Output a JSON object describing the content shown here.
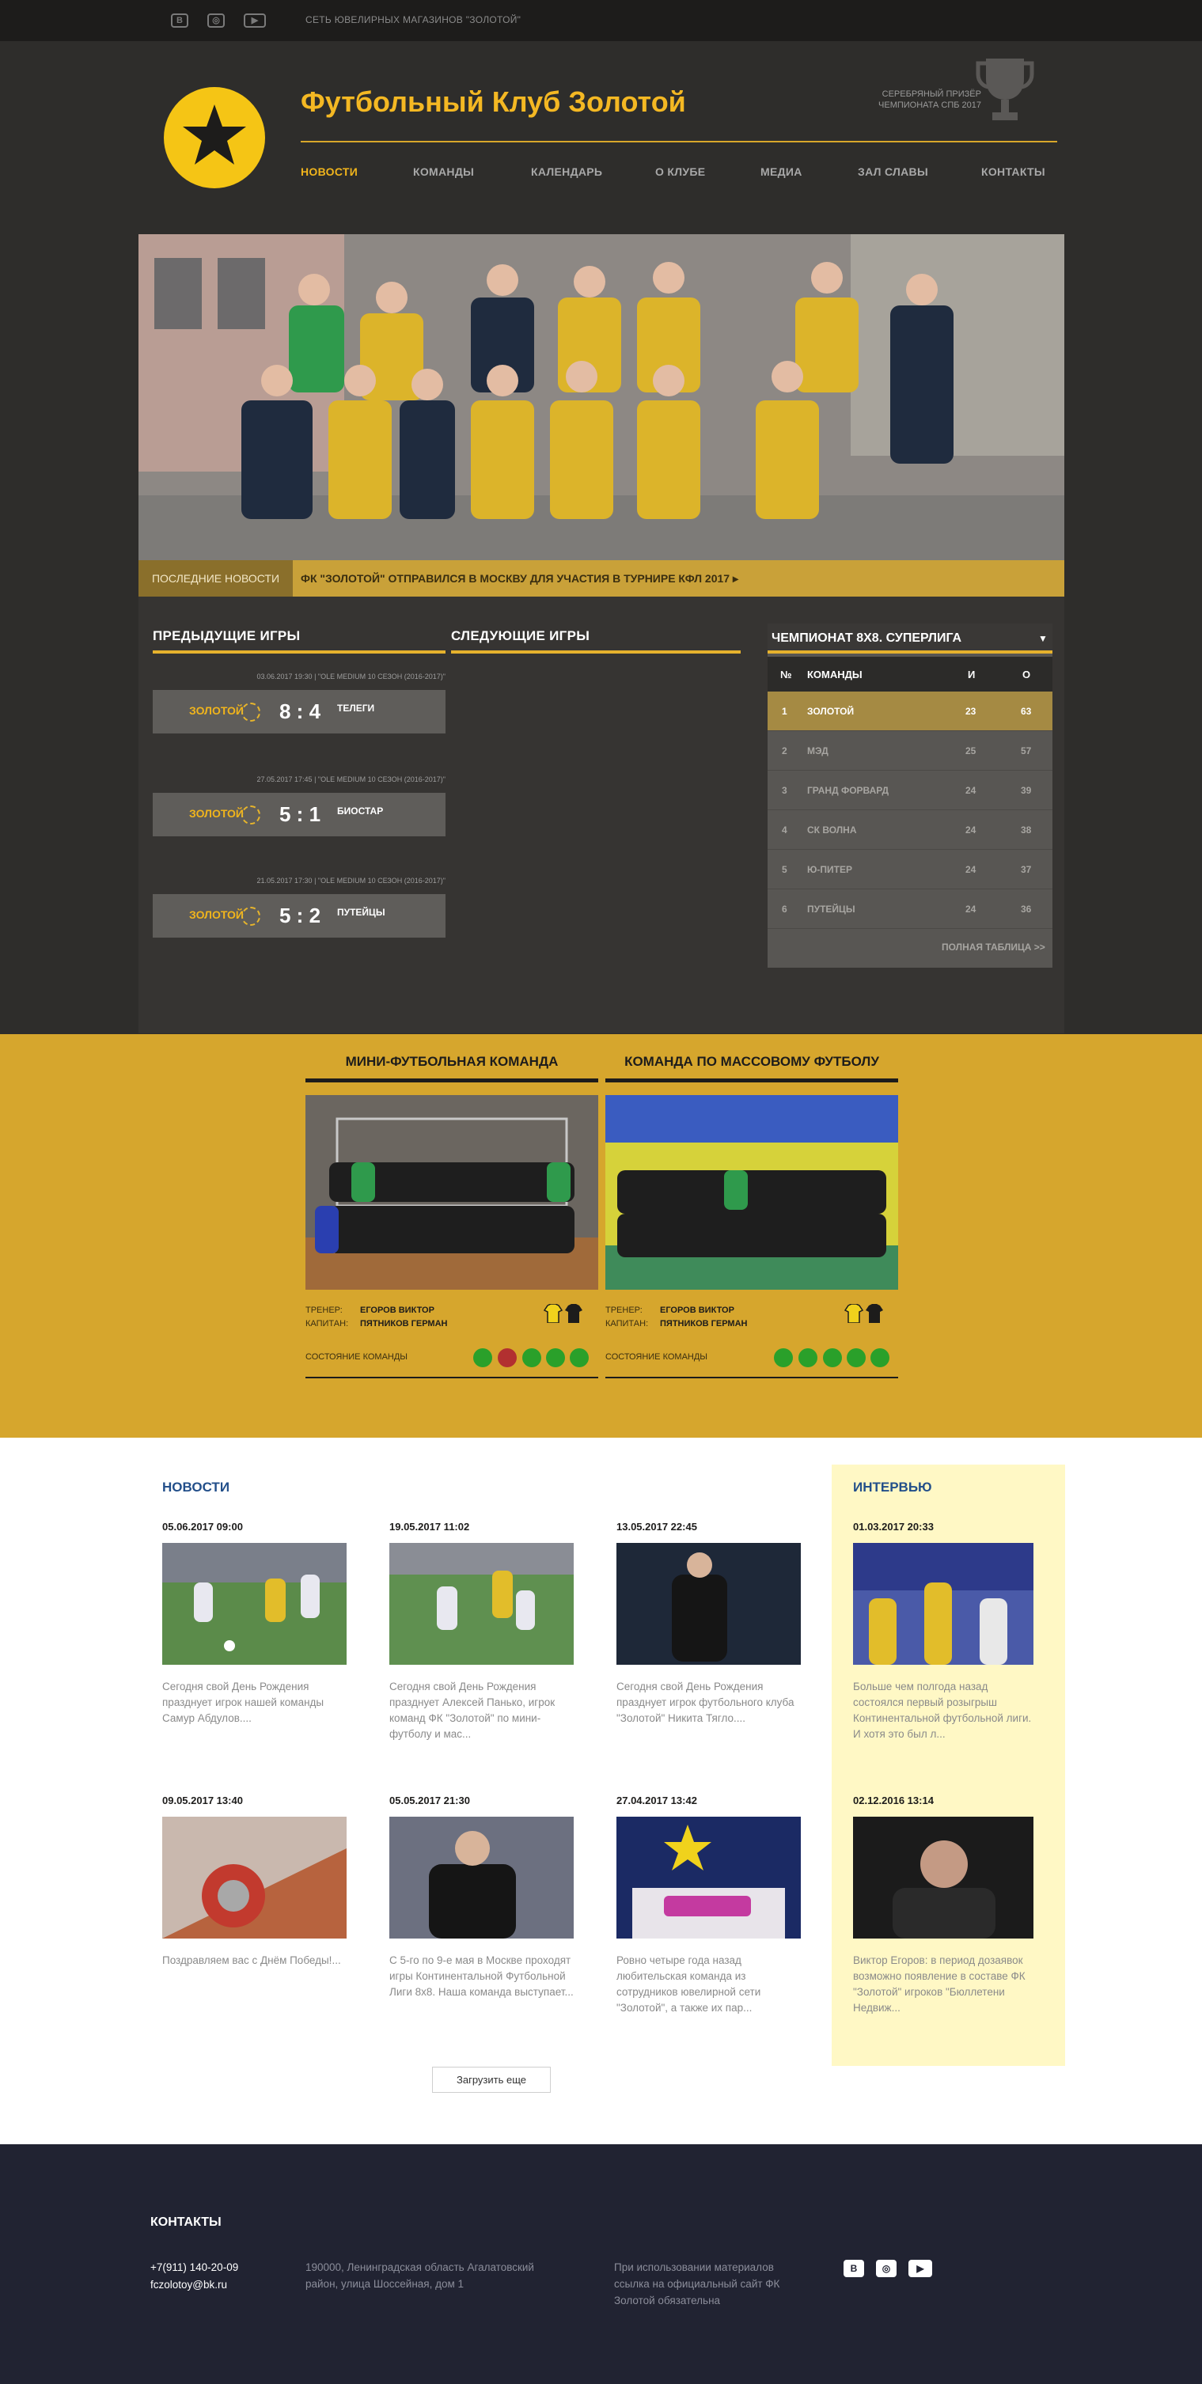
{
  "topbar": {
    "social": [
      "В",
      "◎",
      "▶"
    ],
    "text": "СЕТЬ ЮВЕЛИРНЫХ МАГАЗИНОВ \"ЗОЛОТОЙ\""
  },
  "header": {
    "title": "Футбольный Клуб Золотой",
    "prize": "СЕРЕБРЯНЫЙ ПРИЗЁР ЧЕМПИОНАТА СПБ 2017"
  },
  "nav": [
    "НОВОСТИ",
    "КОМАНДЫ",
    "КАЛЕНДАРЬ",
    "О КЛУБЕ",
    "МЕДИА",
    "ЗАЛ СЛАВЫ",
    "КОНТАКТЫ"
  ],
  "ticker": {
    "label": "ПОСЛЕДНИЕ НОВОСТИ",
    "text": "ФК \"ЗОЛОТОЙ\" ОТПРАВИЛСЯ В МОСКВУ ДЛЯ УЧАСТИЯ В ТУРНИРЕ КФЛ 2017 ▸"
  },
  "games": {
    "prev_title": "ПРЕДЫДУЩИЕ ИГРЫ",
    "next_title": "СЛЕДУЮЩИЕ ИГРЫ",
    "items": [
      {
        "info": "03.06.2017 19:30 | \"OLE MEDIUM 10 СЕЗОН (2016-2017)\"",
        "home": "ЗОЛОТОЙ",
        "score": "8 : 4",
        "away": "ТЕЛЕГИ"
      },
      {
        "info": "27.05.2017 17:45 | \"OLE MEDIUM 10 СЕЗОН (2016-2017)\"",
        "home": "ЗОЛОТОЙ",
        "score": "5 : 1",
        "away": "БИОСТАР"
      },
      {
        "info": "21.05.2017 17:30 | \"OLE MEDIUM 10 СЕЗОН (2016-2017)\"",
        "home": "ЗОЛОТОЙ",
        "score": "5 : 2",
        "away": "ПУТЕЙЦЫ"
      }
    ]
  },
  "standings": {
    "title": "ЧЕМПИОНАТ 8Х8. СУПЕРЛИГА",
    "arrow": "▼",
    "cols": {
      "num": "№",
      "team": "КОМАНДЫ",
      "games": "И",
      "points": "О"
    },
    "rows": [
      {
        "num": "1",
        "team": "ЗОЛОТОЙ",
        "games": "23",
        "points": "63"
      },
      {
        "num": "2",
        "team": "МЭД",
        "games": "25",
        "points": "57"
      },
      {
        "num": "3",
        "team": "ГРАНД ФОРВАРД",
        "games": "24",
        "points": "39"
      },
      {
        "num": "4",
        "team": "СК ВОЛНА",
        "games": "24",
        "points": "38"
      },
      {
        "num": "5",
        "team": "Ю-ПИТЕР",
        "games": "24",
        "points": "37"
      },
      {
        "num": "6",
        "team": "ПУТЕЙЦЫ",
        "games": "24",
        "points": "36"
      }
    ],
    "full": "ПОЛНАЯ ТАБЛИЦА >>"
  },
  "teams": [
    {
      "title": "МИНИ-ФУТБОЛЬНАЯ КОМАНДА",
      "coach_label": "ТРЕНЕР:",
      "coach": "ЕГОРОВ ВИКТОР",
      "captain_label": "КАПИТАН:",
      "captain": "ПЯТНИКОВ ГЕРМАН",
      "state": "СОСТОЯНИЕ КОМАНДЫ"
    },
    {
      "title": "КОМАНДА ПО МАССОВОМУ ФУТБОЛУ",
      "coach_label": "ТРЕНЕР:",
      "coach": "ЕГОРОВ ВИКТОР",
      "captain_label": "КАПИТАН:",
      "captain": "ПЯТНИКОВ ГЕРМАН",
      "state": "СОСТОЯНИЕ КОМАНДЫ"
    }
  ],
  "colors": {
    "gold": "#f4b823",
    "green": "#2aa02a",
    "red": "#b23030",
    "footer": "#212332"
  },
  "news": {
    "title": "НОВОСТИ",
    "items": [
      {
        "date": "05.06.2017 09:00",
        "text": "Сегодня свой День Рождения празднует игрок нашей команды Самур Абдулов...."
      },
      {
        "date": "19.05.2017 11:02",
        "text": "Сегодня свой День Рождения празднует Алексей Панько, игрок команд ФК \"Золотой\" по мини-футболу и мас..."
      },
      {
        "date": "13.05.2017 22:45",
        "text": "Сегодня свой День Рождения празднует игрок футбольного клуба \"Золотой\" Никита Тягло...."
      },
      {
        "date": "09.05.2017 13:40",
        "text": "Поздравляем вас с Днём Победы!..."
      },
      {
        "date": "05.05.2017 21:30",
        "text": "С 5-го по 9-е мая в Москве проходят игры Континентальной Футбольной Лиги 8х8. Наша команда выступает..."
      },
      {
        "date": "27.04.2017 13:42",
        "text": "Ровно четыре года назад любительская команда из сотрудников ювелирной сети \"Золотой\", а также их пар..."
      }
    ],
    "load_more": "Загрузить еще"
  },
  "interview": {
    "title": "ИНТЕРВЬЮ",
    "items": [
      {
        "date": "01.03.2017 20:33",
        "text": "Больше чем полгода назад состоялся первый розыгрыш Континентальной футбольной лиги. И хотя это был л..."
      },
      {
        "date": "02.12.2016 13:14",
        "text": "Виктор Егоров: в период дозаявок возможно появление в составе ФК \"Золотой\" игроков \"Бюллетени Недвиж..."
      }
    ]
  },
  "footer": {
    "title": "КОНТАКТЫ",
    "phone": "+7(911) 140-20-09",
    "email": "fczolotoy@bk.ru",
    "address": "190000, Ленинградская область Агалатовский район, улица Шоссейная, дом 1",
    "notice": "При использовании материалов ссылка на официальный сайт ФК Золотой обязательна",
    "social": [
      "В",
      "◎",
      "▶"
    ]
  }
}
